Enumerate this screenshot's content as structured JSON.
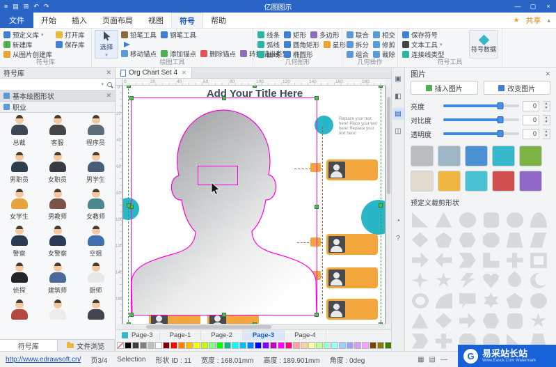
{
  "titlebar": {
    "title": "亿图图示",
    "quick_access": [
      "≡",
      "▤",
      "⊞",
      "↶",
      "↷"
    ],
    "window_controls": [
      "—",
      "▢",
      "×"
    ]
  },
  "tabrow": {
    "file": "文件",
    "tabs": [
      {
        "label": "开始",
        "cls": ""
      },
      {
        "label": "插入",
        "cls": ""
      },
      {
        "label": "页面布局",
        "cls": ""
      },
      {
        "label": "视图",
        "cls": ""
      },
      {
        "label": "符号",
        "cls": "active"
      },
      {
        "label": "帮助",
        "cls": ""
      }
    ],
    "share": "共享"
  },
  "ribbon": {
    "groups": {
      "symbol_lib": {
        "label": "符号库",
        "col1": [
          {
            "t": "预定义库",
            "c": "#3f7fd4",
            "caret": "▾"
          },
          {
            "t": "新建库",
            "c": "#4caf50",
            "caret": ""
          },
          {
            "t": "从图片创建库",
            "c": "#f0a030",
            "caret": ""
          }
        ],
        "col2": [
          {
            "t": "打开库",
            "c": "#e8b93e",
            "caret": ""
          },
          {
            "t": "保存库",
            "c": "#3f7fd4",
            "caret": ""
          }
        ]
      },
      "draw": {
        "label": "绘图工具",
        "select": "选择",
        "row1": [
          {
            "t": "铅笔工具",
            "c": "#8a6d3b"
          },
          {
            "t": "钢笔工具",
            "c": "#3f7fd4"
          }
        ],
        "row2": [
          {
            "t": "移动锚点",
            "c": "#5a9bd5"
          },
          {
            "t": "添加锚点",
            "c": "#4caf50"
          },
          {
            "t": "删除锚点",
            "c": "#e05555"
          },
          {
            "t": "转换锚点类型",
            "c": "#8e6bbf"
          }
        ]
      },
      "geometry": {
        "label": "几何图形",
        "row1": [
          {
            "t": "线条",
            "c": "#2ab5a5"
          },
          {
            "t": "矩形",
            "c": "#3f7fd4"
          },
          {
            "t": "多边形",
            "c": "#8e6bbf"
          }
        ],
        "row2": [
          {
            "t": "弧线",
            "c": "#2ab5a5"
          },
          {
            "t": "圆角矩形",
            "c": "#3f7fd4"
          },
          {
            "t": "星形",
            "c": "#f0a030"
          }
        ],
        "row3": [
          {
            "t": "曲线",
            "c": "#2ab5a5"
          },
          {
            "t": "椭圆形",
            "c": "#3f7fd4"
          }
        ]
      },
      "geo_ops": {
        "label": "几何操作",
        "row1": [
          {
            "t": "联合",
            "c": "#5a9bd5"
          },
          {
            "t": "相交",
            "c": "#5a9bd5"
          }
        ],
        "row2": [
          {
            "t": "拆分",
            "c": "#5a9bd5"
          },
          {
            "t": "修剪",
            "c": "#5a9bd5"
          }
        ],
        "row3": [
          {
            "t": "组合",
            "c": "#5a9bd5"
          },
          {
            "t": "裁除",
            "c": "#5a9bd5"
          }
        ]
      },
      "symbol_tools": {
        "label": "符号工具",
        "col": [
          {
            "t": "保存符号",
            "c": "#3f7fd4",
            "caret": ""
          },
          {
            "t": "文本工具",
            "c": "#444444",
            "caret": "▾"
          },
          {
            "t": "连接线类型",
            "c": "#2ab5a5",
            "caret": ""
          }
        ],
        "data_btn": "符号数据"
      }
    }
  },
  "library_panel": {
    "title": "符号库",
    "section_basic": "基本绘图形状",
    "section_occupation": "职业",
    "items": [
      {
        "label": "总裁",
        "c": "#3d4757"
      },
      {
        "label": "客服",
        "c": "#454545"
      },
      {
        "label": "程序员",
        "c": "#5a6b7a"
      },
      {
        "label": "男职员",
        "c": "#2f3e4e"
      },
      {
        "label": "女职员",
        "c": "#3a3a44"
      },
      {
        "label": "男学生",
        "c": "#4a5d78"
      },
      {
        "label": "女学生",
        "c": "#e8a33d"
      },
      {
        "label": "男教师",
        "c": "#7a5545"
      },
      {
        "label": "女教师",
        "c": "#4a8a8f"
      },
      {
        "label": "警察",
        "c": "#2b3a55"
      },
      {
        "label": "女警察",
        "c": "#2b3a55"
      },
      {
        "label": "空姐",
        "c": "#3f6fae"
      },
      {
        "label": "侦探",
        "c": "#22252a"
      },
      {
        "label": "建筑师",
        "c": "#4a6a9a"
      },
      {
        "label": "厨师",
        "c": "#e8e8e8"
      },
      {
        "label": "",
        "c": "#b5483f"
      },
      {
        "label": "",
        "c": "#ececec"
      },
      {
        "label": "",
        "c": "#41454d"
      }
    ],
    "bottom_tabs": {
      "library": "符号库",
      "file_browser": "文件浏览"
    }
  },
  "document": {
    "tab_title": "Org Chart Set 4",
    "ruler_h": [
      "0",
      "20",
      "40",
      "60",
      "80",
      "100",
      "120",
      "140",
      "160",
      "180"
    ],
    "ruler_v": [
      "0",
      "20",
      "40",
      "60",
      "80",
      "100",
      "120",
      "140",
      "160"
    ],
    "nav_label": "Page-3",
    "pages": [
      {
        "label": "Page-1",
        "cls": ""
      },
      {
        "label": "Page-2",
        "cls": ""
      },
      {
        "label": "Page-3",
        "cls": "active"
      },
      {
        "label": "Page-4",
        "cls": ""
      }
    ],
    "template": {
      "title": "Add Your Title Here",
      "blurb": "Replace your text here! Place your text here! Replace your text here!"
    }
  },
  "picture_panel": {
    "title": "图片",
    "insert_button": "插入图片",
    "change_button": "改变图片",
    "sliders": [
      {
        "label": "亮度",
        "value": "0"
      },
      {
        "label": "对比度",
        "value": "0"
      },
      {
        "label": "透明度",
        "value": "0"
      }
    ],
    "thumbs": [
      "#b9bdc1",
      "#9fb6c6",
      "#4a90d2",
      "#35b8c9",
      "#7cb446",
      "#e2dccf",
      "#f0b840",
      "#49c3d4",
      "#d05050",
      "#9068c8"
    ],
    "crop_label": "预定义裁剪形状",
    "shapes": [
      "s-trir",
      "s-tri",
      "s-cir",
      "s-rsq",
      "s-pill",
      "s-half",
      "s-dia",
      "s-pen",
      "s-hex",
      "s-oct",
      "s-tra",
      "s-par",
      "s-arr",
      "s-arl",
      "s-che",
      "s-lsh",
      "s-cro",
      "s-fra",
      "s-st4",
      "s-st5",
      "s-lig",
      "s-hea",
      "s-tdr",
      "s-cre",
      "s-rin",
      "s-qua",
      "s-spe",
      "s-st6",
      "s-pen",
      "s-cir",
      "s-tri",
      "s-dia",
      "s-arr",
      "s-hex",
      "s-rsq",
      "s-st5",
      "s-che",
      "s-cro",
      "s-oct",
      "s-pill",
      "s-trir",
      "s-tra"
    ]
  },
  "palette": [
    "#000000",
    "#3f3f3f",
    "#7f7f7f",
    "#bfbfbf",
    "#ffffff",
    "#7f0000",
    "#ff0000",
    "#ff7f00",
    "#ffbf00",
    "#ffff00",
    "#bfff00",
    "#7fff7f",
    "#00ff00",
    "#00bf7f",
    "#00ffff",
    "#00bfff",
    "#007fff",
    "#0000ff",
    "#7f00ff",
    "#bf00bf",
    "#ff00ff",
    "#ff007f",
    "#ff9f9f",
    "#ffcf9f",
    "#ffff9f",
    "#bfff9f",
    "#9fffcf",
    "#9fffff",
    "#9fcfff",
    "#9f9fff",
    "#cf9fff",
    "#ff9fff",
    "#7f3f00",
    "#7f7f00",
    "#3f7f00"
  ],
  "rstrip": {
    "format": "▣",
    "style": "◧",
    "picture": "▤",
    "layers": "◫",
    "chart": "◔",
    "help": "?"
  },
  "statusbar": {
    "url": "http://www.edrawsoft.cn/",
    "page": "页3/4",
    "mode": "Selection",
    "shape_id": "形状 ID : 11",
    "width": "宽度 : 168.01mm",
    "height": "高度 : 189.901mm",
    "angle": "角度 : 0deg"
  },
  "watermark": {
    "logo": "G",
    "name": "易采站长站",
    "sub": "Www.Easck.Com Watermark"
  }
}
